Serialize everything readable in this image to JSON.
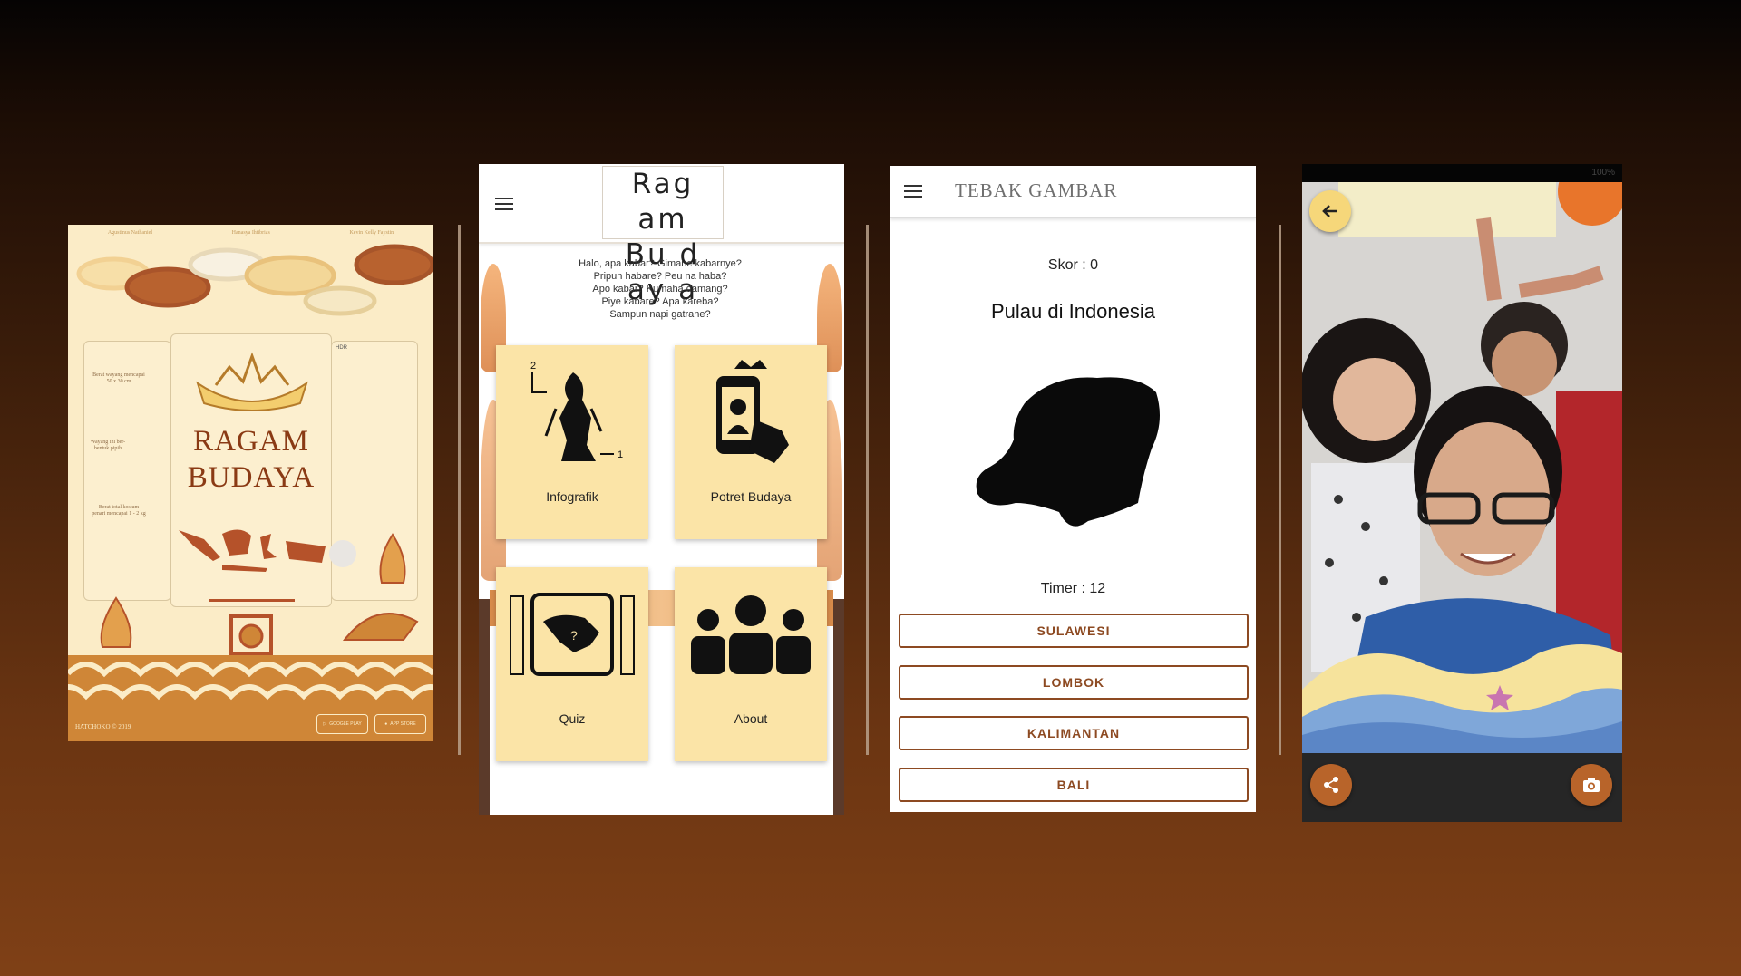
{
  "colors": {
    "brand_brown": "#8d4a22",
    "card_cream": "#fbe4a7",
    "poster_bg": "#fbecc7",
    "accent_orange": "#d87c3a",
    "camera_fab": "#b8642a",
    "back_fab": "#f6d77a"
  },
  "poster": {
    "credits": [
      "Agustinus Nathaniel",
      "Hanasya Ihtibrias",
      "Kevin Kelly Faystin"
    ],
    "title_line1": "RAGAM",
    "title_line2": "BUDAYA",
    "notes": [
      "Berat wayang mencapai 50 x 30 cm",
      "Wayang ini ber- bentuk pipih",
      "Berat total kostum penari mencapai 1 - 2 kg"
    ],
    "hdr_label": "HDR",
    "footer": "HATCHOKO © 2019",
    "store_badges": [
      "GOOGLE PLAY",
      "APP STORE"
    ],
    "icons": [
      "crown-icon",
      "indonesia-map-icon",
      "gunungan-icon",
      "gong-icon",
      "ship-icon"
    ]
  },
  "home": {
    "logo_line1": "Rag am",
    "logo_line2": "Bu d ay a",
    "menu_icon": "hamburger-icon",
    "greeting": [
      "Halo, apa kabar? Gimane kabarnye?",
      "Pripun habare? Peu na haba?",
      "Apo kabar? Kumaha damang?",
      "Piye kabare? Apa kareba?",
      "Sampun napi gatrane?"
    ],
    "cards": [
      {
        "label": "Infografik",
        "icon": "wayang-icon"
      },
      {
        "label": "Potret Budaya",
        "icon": "phone-selfie-icon"
      },
      {
        "label": "Quiz",
        "icon": "island-question-icon"
      },
      {
        "label": "About",
        "icon": "people-group-icon"
      }
    ],
    "infografik_marks": [
      "2",
      "1"
    ]
  },
  "quiz": {
    "title": "TEBAK GAMBAR",
    "score": "Skor : 0",
    "question": "Pulau di Indonesia",
    "image_icon": "lombok-island-silhouette",
    "timer": "Timer : 12",
    "answers": [
      "SULAWESI",
      "LOMBOK",
      "KALIMANTAN",
      "BALI"
    ]
  },
  "camera": {
    "status_text": "100%",
    "back_icon": "arrow-left-icon",
    "share_icon": "share-icon",
    "capture_icon": "camera-icon"
  }
}
